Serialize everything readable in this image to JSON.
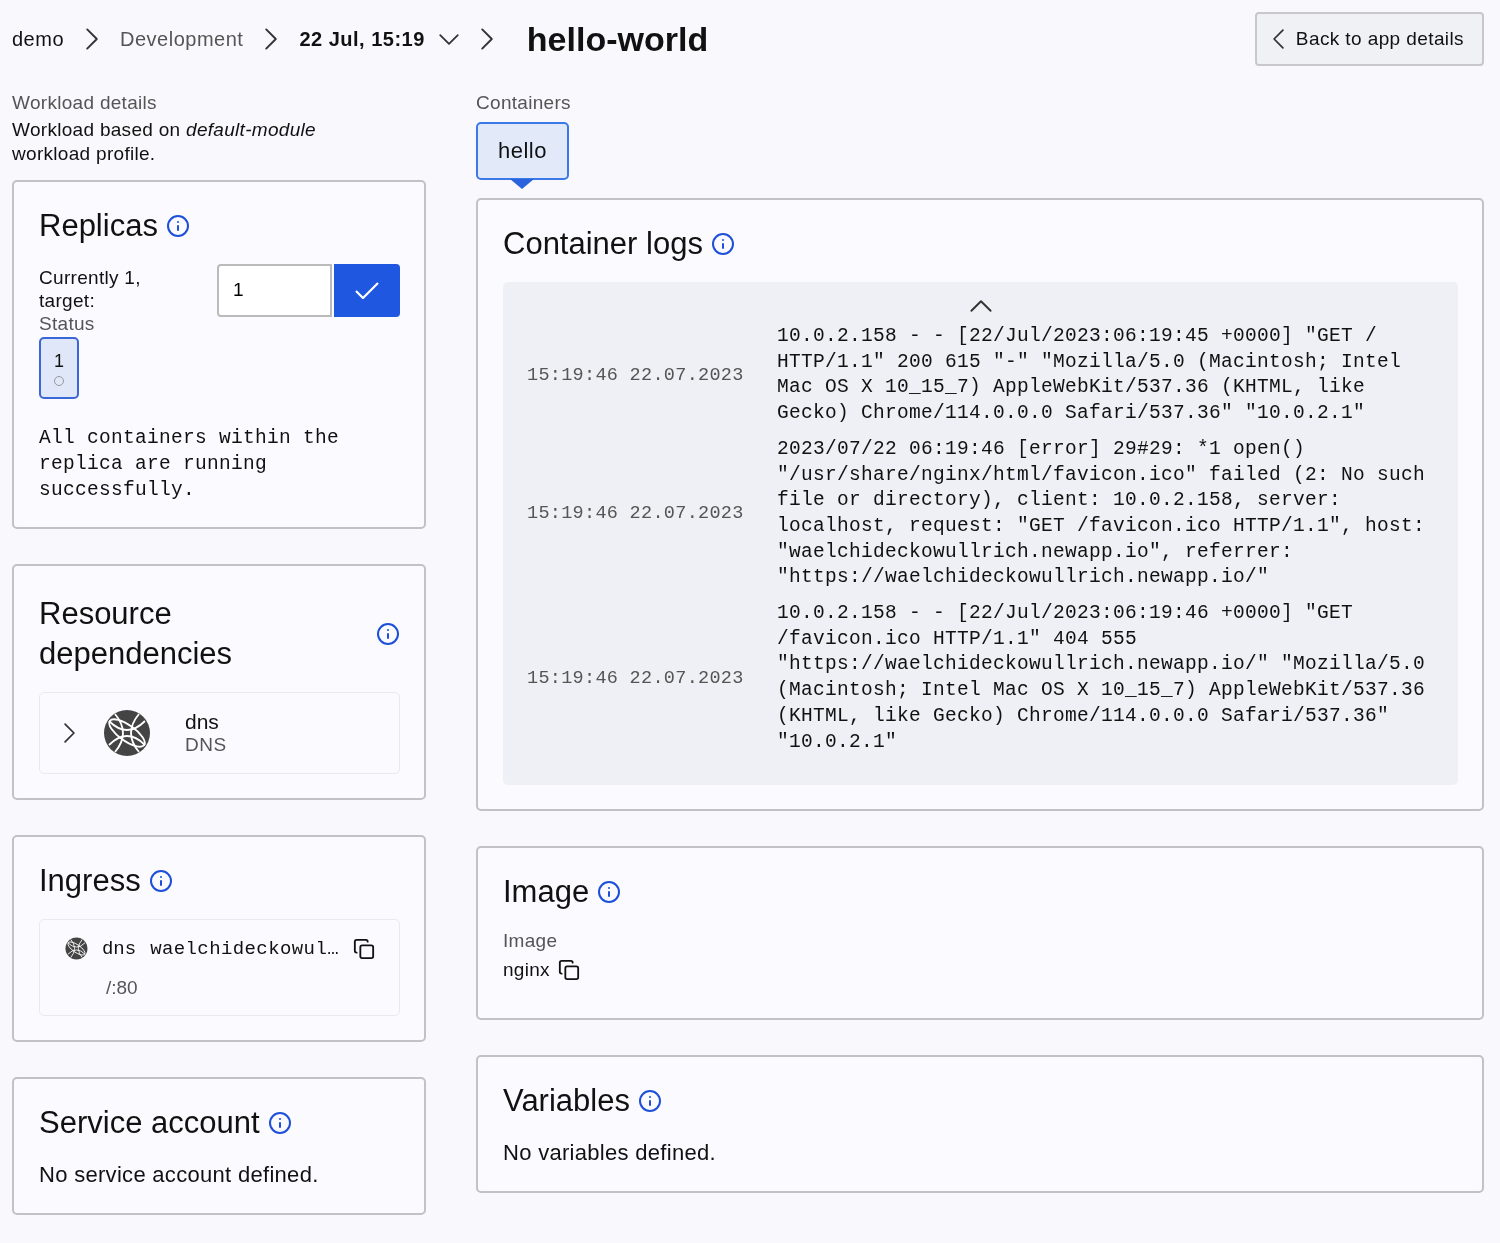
{
  "breadcrumb": {
    "items": [
      {
        "label": "demo",
        "kind": "link"
      },
      {
        "label": "Development",
        "kind": "muted"
      },
      {
        "label": "22 Jul, 15:19",
        "kind": "dropdown"
      }
    ],
    "title": "hello-world"
  },
  "back_button": "Back to app details",
  "workload": {
    "heading": "Workload details",
    "description": "Workload based on *default-module* workload profile."
  },
  "replicas": {
    "title": "Replicas",
    "current_label": "Currently 1, target:",
    "target_value": "1",
    "status_label": "Status",
    "pods": [
      {
        "label": "1"
      }
    ],
    "message": "All containers within the replica are running successfully."
  },
  "resource_dependencies": {
    "title": "Resource dependencies",
    "items": [
      {
        "name": "dns",
        "type": "DNS",
        "expanded": false
      }
    ]
  },
  "ingress": {
    "title": "Ingress",
    "items": [
      {
        "resource": "dns",
        "host": "waelchideckowul…",
        "path": "/:80"
      }
    ]
  },
  "service_account": {
    "title": "Service account",
    "message": "No service account defined."
  },
  "containers": {
    "label": "Containers",
    "tabs": [
      {
        "label": "hello",
        "selected": true
      }
    ]
  },
  "logs": {
    "title": "Container logs",
    "entries": [
      {
        "time": "15:19:46 22.07.2023",
        "message": "10.0.2.158 - - [22/Jul/2023:06:19:45 +0000] \"GET / HTTP/1.1\" 200 615 \"-\" \"Mozilla/5.0 (Macintosh; Intel Mac OS X 10_15_7) AppleWebKit/537.36 (KHTML, like Gecko) Chrome/114.0.0.0 Safari/537.36\" \"10.0.2.1\""
      },
      {
        "time": "15:19:46 22.07.2023",
        "message": "2023/07/22 06:19:46 [error] 29#29: *1 open() \"/usr/share/nginx/html/favicon.ico\" failed (2: No such file or directory), client: 10.0.2.158, server: localhost, request: \"GET /favicon.ico HTTP/1.1\", host: \"waelchideckowullrich.newapp.io\", referrer: \"https://waelchideckowullrich.newapp.io/\""
      },
      {
        "time": "15:19:46 22.07.2023",
        "message": "10.0.2.158 - - [22/Jul/2023:06:19:46 +0000] \"GET /favicon.ico HTTP/1.1\" 404 555 \"https://waelchideckowullrich.newapp.io/\" \"Mozilla/5.0 (Macintosh; Intel Mac OS X 10_15_7) AppleWebKit/537.36 (KHTML, like Gecko) Chrome/114.0.0.0 Safari/537.36\" \"10.0.2.1\""
      }
    ]
  },
  "image": {
    "title": "Image",
    "label": "Image",
    "value": "nginx"
  },
  "variables": {
    "title": "Variables",
    "message": "No variables defined."
  }
}
